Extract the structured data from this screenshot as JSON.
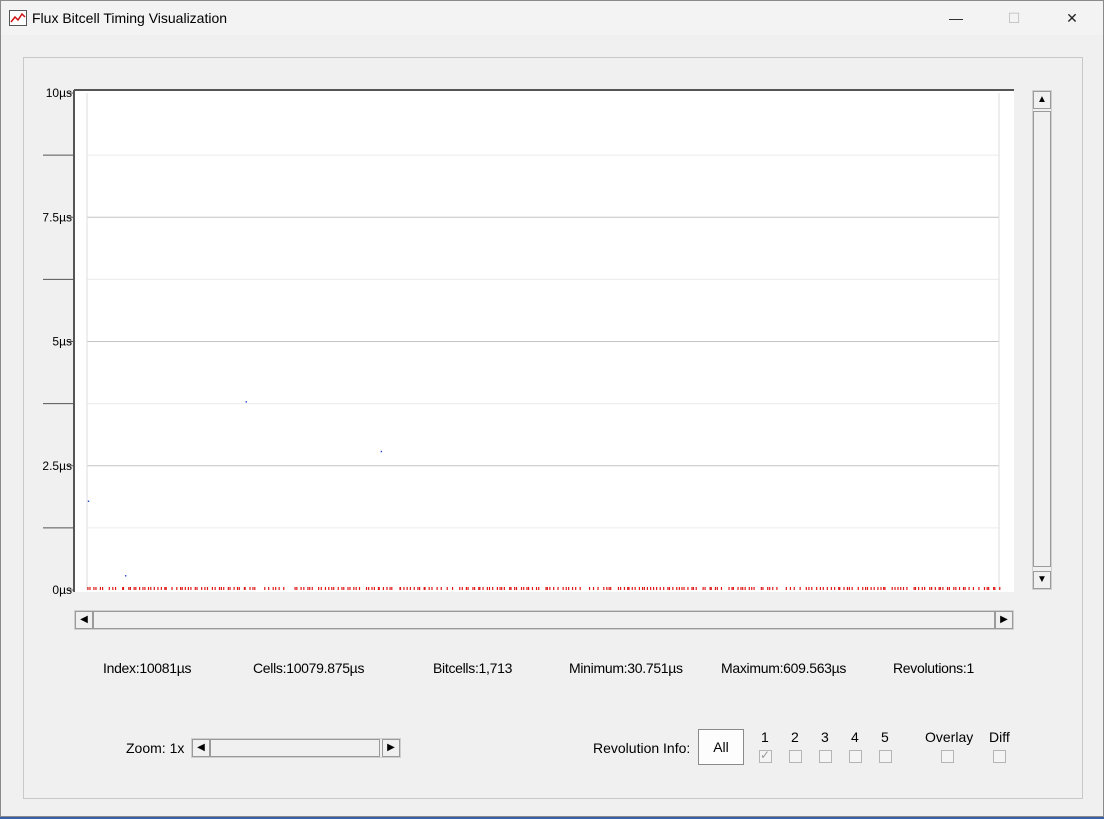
{
  "window": {
    "title": "Flux Bitcell Timing Visualization",
    "controls": {
      "minimize": "—",
      "maximize": "☐",
      "close": "✕"
    }
  },
  "chart_data": {
    "type": "scatter",
    "ylabel": "",
    "xlabel": "",
    "ylim": [
      0,
      10
    ],
    "y_ticks": [
      "10µs",
      "7.5µs",
      "5µs",
      "2.5µs",
      "0µs"
    ],
    "grid": true,
    "series": [
      {
        "color": "#1a3fd0",
        "x": [
          20,
          430,
          1760,
          3250
        ],
        "y": [
          1.8,
          0.3,
          3.8,
          2.8
        ]
      },
      {
        "color": "#e01818",
        "x_range": [
          0,
          10081
        ],
        "y_value": 0.0,
        "count": 300
      }
    ]
  },
  "stats": {
    "index": "Index:10081µs",
    "cells": "Cells:10079.875µs",
    "bitcells": "Bitcells:1,713",
    "minimum": "Minimum:30.751µs",
    "maximum": "Maximum:609.563µs",
    "revolutions": "Revolutions:1"
  },
  "zoom": {
    "label": "Zoom: 1x"
  },
  "revolution": {
    "label": "Revolution Info:",
    "all_button": "All",
    "checkboxes": [
      {
        "label": "1",
        "checked": true
      },
      {
        "label": "2",
        "checked": false
      },
      {
        "label": "3",
        "checked": false
      },
      {
        "label": "4",
        "checked": false
      },
      {
        "label": "5",
        "checked": false
      },
      {
        "label": "Overlay",
        "checked": false
      },
      {
        "label": "Diff",
        "checked": false
      }
    ]
  },
  "colors": {
    "accent_red": "#e01818",
    "point_blue": "#1a3fd0",
    "grid": "#c8c8c8"
  }
}
